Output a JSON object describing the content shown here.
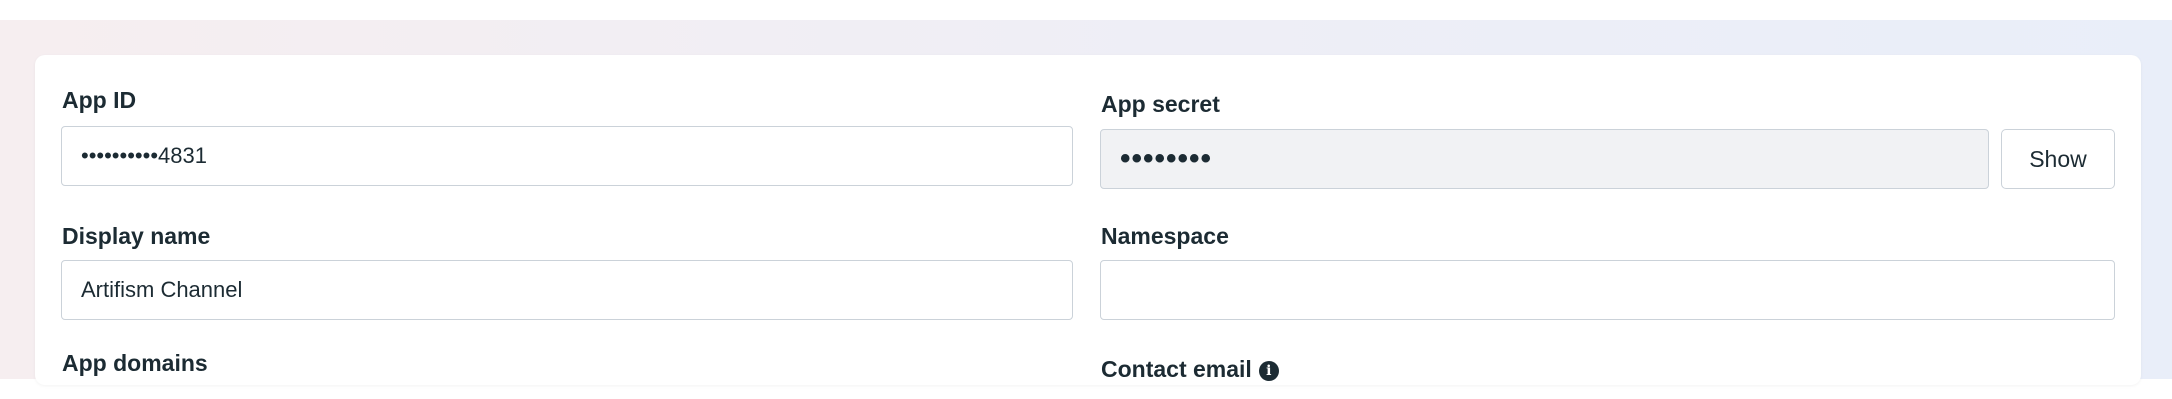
{
  "form": {
    "app_id": {
      "label": "App ID",
      "value": "••••••••••4831"
    },
    "app_secret": {
      "label": "App secret",
      "value": "••••••••",
      "show_label": "Show"
    },
    "display_name": {
      "label": "Display name",
      "value": "Artifism Channel"
    },
    "namespace": {
      "label": "Namespace",
      "value": ""
    },
    "app_domains": {
      "label": "App domains"
    },
    "contact_email": {
      "label": "Contact email",
      "info_glyph": "i"
    }
  },
  "colors": {
    "text": "#1c2b33",
    "border": "#cbd2d9",
    "disabled_field": "#f1f2f4"
  },
  "icons": [
    "info-icon"
  ]
}
